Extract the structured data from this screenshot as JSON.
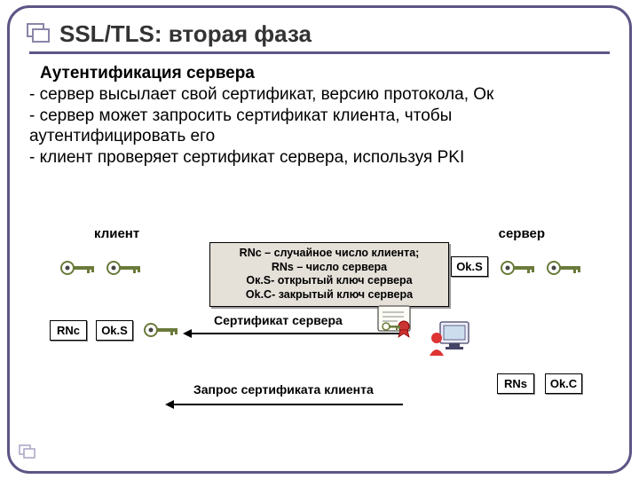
{
  "title": "SSL/TLS: вторая фаза",
  "subtitle": "Аутентификация сервера",
  "bullets": [
    "-  сервер высылает свой сертификат, версию протокола, Ок",
    "-  сервер может запросить сертификат клиента, чтобы аутентифицировать его",
    "-  клиент проверяет сертификат сервера, используя PKI"
  ],
  "labels": {
    "client": "клиент",
    "server": "сервер"
  },
  "note": {
    "l1": "RNc – случайное число клиента;",
    "l2": "RNs – число сервера",
    "l3": "Ок.S- открытый ключ сервера",
    "l4": "Ok.C- закрытый ключ сервера"
  },
  "boxes": {
    "rnc": "RNc",
    "oks_left": "Ok.S",
    "oks_right": "Ok.S",
    "rns": "RNs",
    "okc": "Ok.C"
  },
  "arrows": {
    "cert": "Сертификат сервера",
    "req": "Запрос сертификата клиента"
  },
  "icons": {
    "bullet": "title-bullet-icon",
    "key": "key-icon",
    "cert": "certificate-icon",
    "client": "client-monitor-icon"
  }
}
